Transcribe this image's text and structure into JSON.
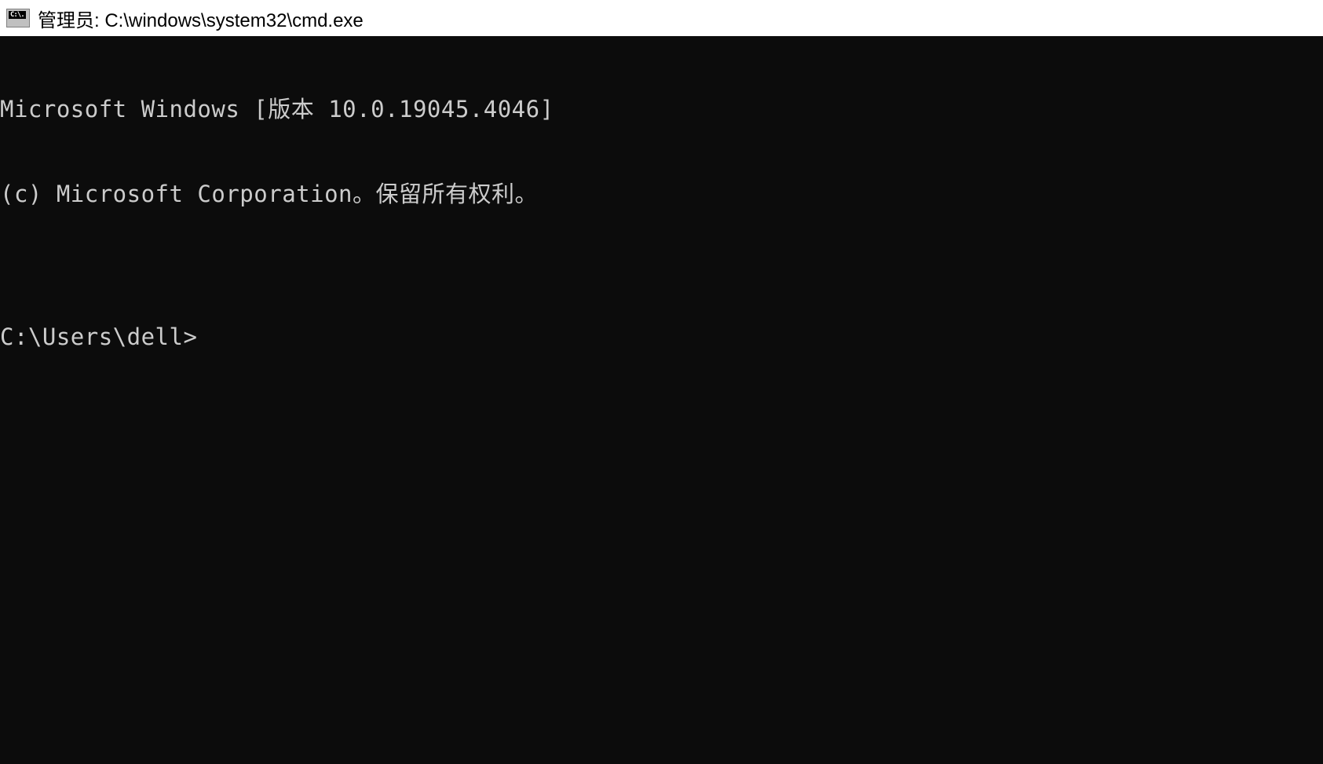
{
  "titlebar": {
    "icon_label": "cmd-icon",
    "title": "管理员: C:\\windows\\system32\\cmd.exe"
  },
  "terminal": {
    "lines": [
      "Microsoft Windows [版本 10.0.19045.4046]",
      "(c) Microsoft Corporation。保留所有权利。",
      ""
    ],
    "prompt": "C:\\Users\\dell>",
    "input_value": ""
  }
}
